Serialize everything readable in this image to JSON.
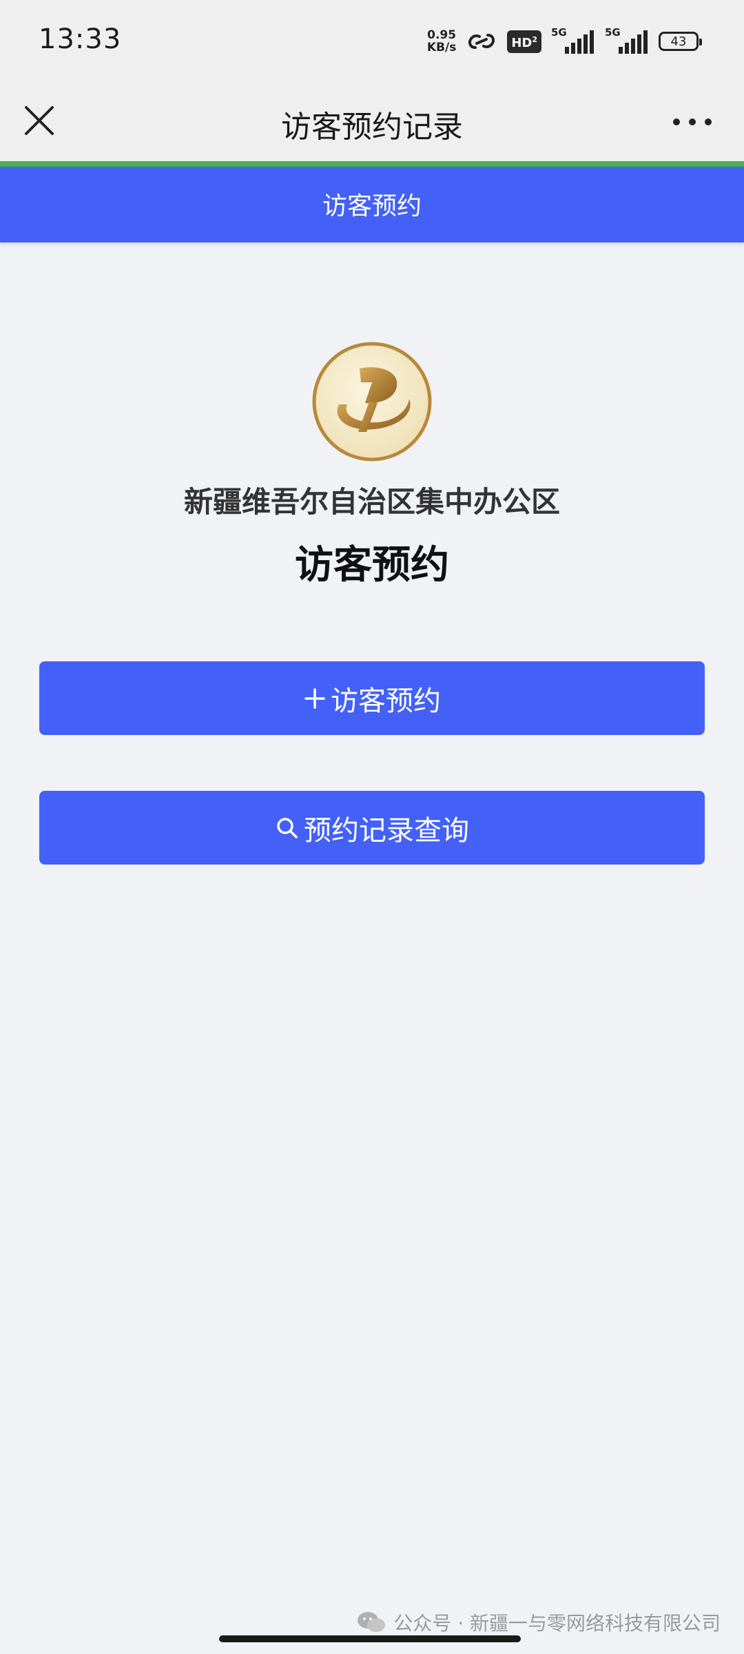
{
  "status_bar": {
    "time": "13:33",
    "net_speed_value": "0.95",
    "net_speed_unit": "KB/s",
    "hd_label": "HD",
    "hd_sub": "2",
    "sim1_label": "5G",
    "sim2_label": "5G",
    "battery": "43"
  },
  "title_bar": {
    "title": "访客预约记录"
  },
  "header": {
    "title": "访客预约"
  },
  "main": {
    "org_name": "新疆维吾尔自治区集中办公区",
    "title": "访客预约"
  },
  "actions": {
    "appoint_label": "访客预约",
    "query_label": "预约记录查询"
  },
  "footer": {
    "watermark": "公众号 · 新疆一与零网络科技有限公司"
  },
  "colors": {
    "accent": "#4361f7",
    "progress": "#4caf50",
    "background": "#f0f2f6",
    "logo_gold": "#b8893a"
  }
}
